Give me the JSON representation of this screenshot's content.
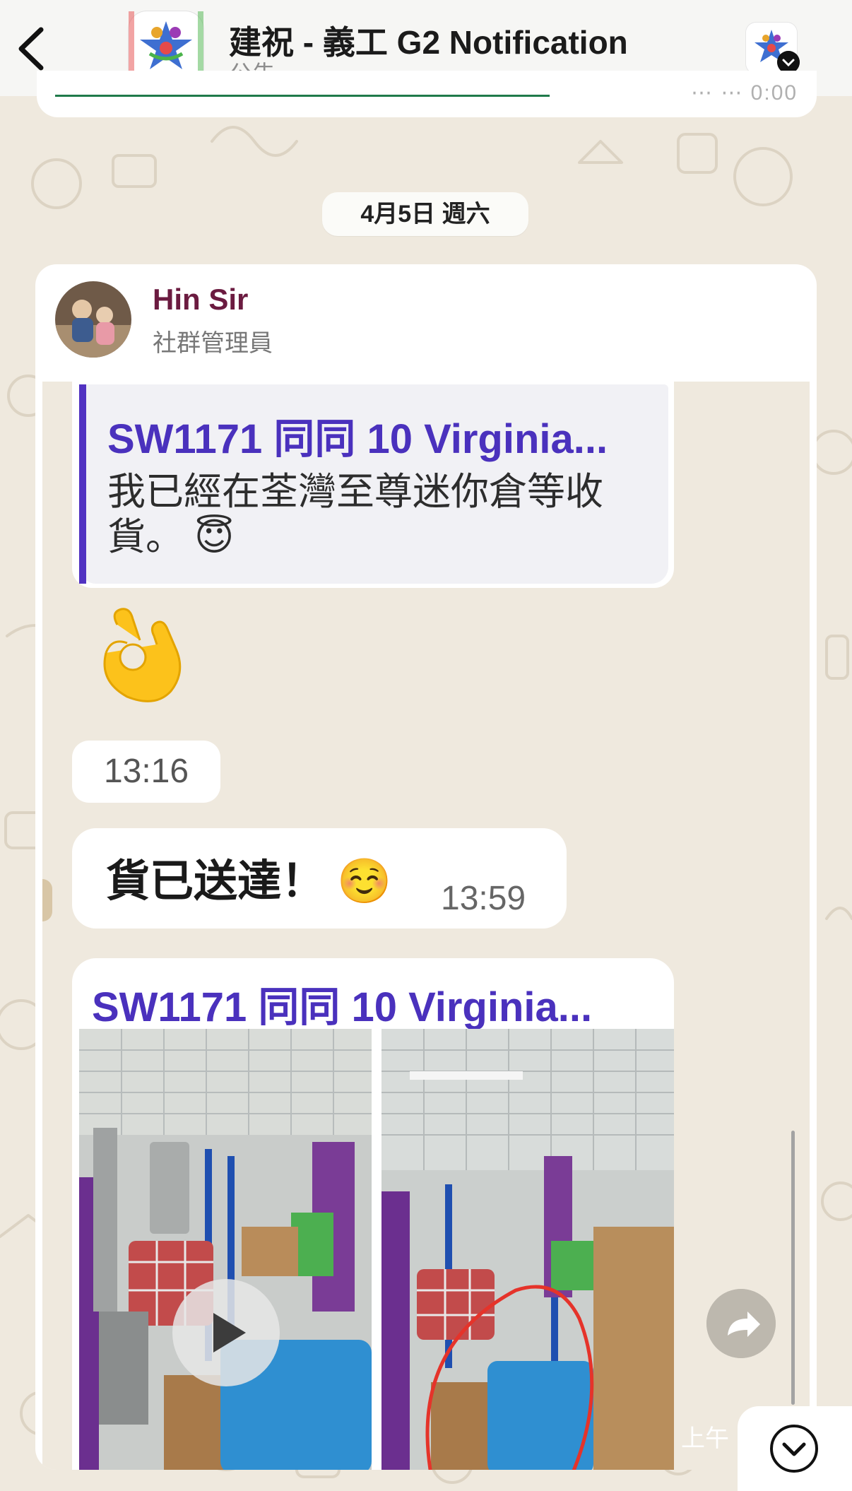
{
  "header": {
    "title": "建祝 - 義工 G2 Notification",
    "subtitle": "公告"
  },
  "previous_message": {
    "time_partial": "⋯ ⋯ 0:00"
  },
  "date_divider": "4月5日 週六",
  "message": {
    "sender_name": "Hin Sir",
    "sender_role": "社群管理員",
    "quote": {
      "title": "SW1171 同同 10 Virginia...",
      "body": "我已經在荃灣至尊迷你倉等收貨。 😇"
    },
    "emoji_reply": "👌",
    "emoji_time": "13:16",
    "reply": {
      "text": "貨已送達！ ☺️",
      "time": "13:59"
    },
    "media_title": "SW1171 同同 10 Virginia...",
    "media_time_partial": "上午"
  },
  "colors": {
    "wallpaper": "#efe9de",
    "sender_name": "#6b1b40",
    "quote_accent": "#4a31bd"
  },
  "icons": {
    "back": "chevron-left-icon",
    "forward": "forward-arrow-icon",
    "play": "play-icon",
    "scroll_down": "chevron-down-icon"
  }
}
